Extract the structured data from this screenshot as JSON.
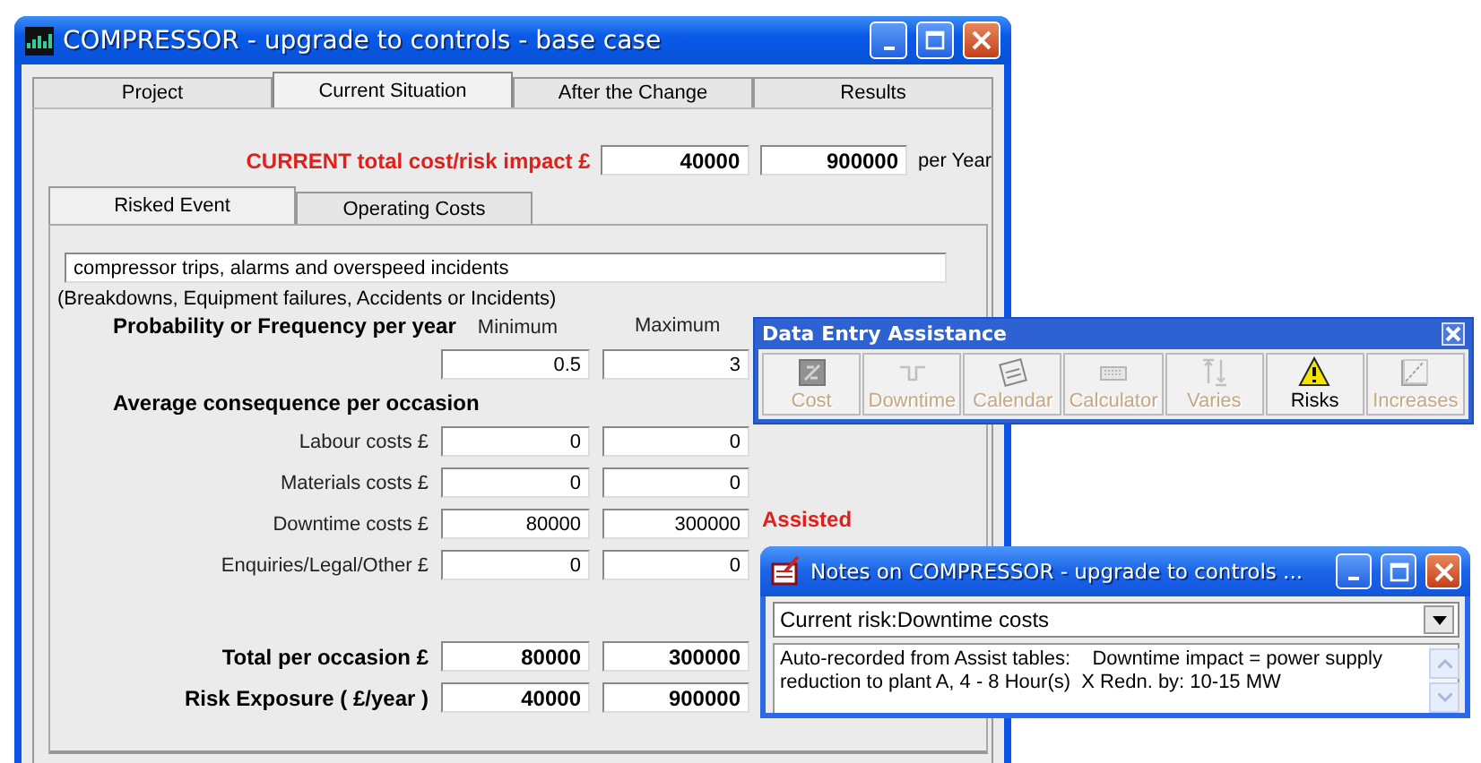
{
  "window": {
    "title": "COMPRESSOR - upgrade to controls - base case"
  },
  "tabs": [
    {
      "label": "Project",
      "selected": false
    },
    {
      "label": "Current Situation",
      "selected": true
    },
    {
      "label": "After the Change",
      "selected": false
    },
    {
      "label": "Results",
      "selected": false
    }
  ],
  "total_impact": {
    "label": "CURRENT total cost/risk impact £",
    "minimum": "40000",
    "maximum": "900000",
    "unit": "per Year"
  },
  "subtabs": [
    {
      "label": "Risked Event",
      "selected": true
    },
    {
      "label": "Operating Costs",
      "selected": false
    }
  ],
  "event": {
    "value": "compressor trips, alarms and overspeed incidents",
    "hint": "(Breakdowns, Equipment failures, Accidents or Incidents)"
  },
  "probability": {
    "label": "Probability or Frequency per year",
    "min_header": "Minimum",
    "max_header": "Maximum",
    "minimum": "0.5",
    "maximum": "3"
  },
  "consequence": {
    "heading": "Average consequence per occasion",
    "rows": [
      {
        "label": "Labour costs £",
        "minimum": "0",
        "maximum": "0"
      },
      {
        "label": "Materials costs £",
        "minimum": "0",
        "maximum": "0"
      },
      {
        "label": "Downtime costs £",
        "minimum": "80000",
        "maximum": "300000",
        "note": "Assisted"
      },
      {
        "label": "Enquiries/Legal/Other £",
        "minimum": "0",
        "maximum": "0"
      }
    ]
  },
  "totals": [
    {
      "label": "Total per occasion £",
      "minimum": "80000",
      "maximum": "300000"
    },
    {
      "label": "Risk Exposure ( £/year )",
      "minimum": "40000",
      "maximum": "900000"
    }
  ],
  "assistance": {
    "title": "Data Entry Assistance",
    "tools": [
      {
        "label": "Cost",
        "disabled": true
      },
      {
        "label": "Downtime",
        "disabled": true
      },
      {
        "label": "Calendar",
        "disabled": true
      },
      {
        "label": "Calculator",
        "disabled": true
      },
      {
        "label": "Varies",
        "disabled": true
      },
      {
        "label": "Risks",
        "disabled": false
      },
      {
        "label": "Increases",
        "disabled": true
      }
    ]
  },
  "notes": {
    "title": "Notes on COMPRESSOR - upgrade to controls ...",
    "risk": "Current risk:Downtime costs",
    "text": "Auto-recorded from Assist tables:    Downtime impact = power supply reduction to plant A, 4 - 8 Hour(s)  X Redn. by: 10-15 MW"
  }
}
